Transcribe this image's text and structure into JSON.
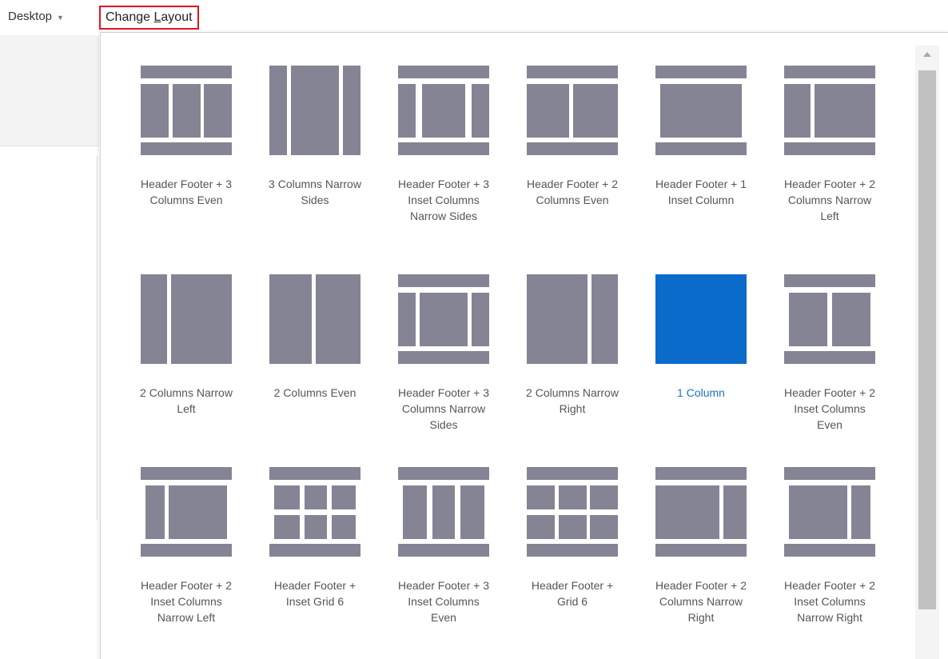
{
  "topbar": {
    "device": "Desktop",
    "change_layout_pre": "Change ",
    "change_layout_key": "L",
    "change_layout_post": "ayout"
  },
  "layouts": [
    "Header Footer + 3 Columns Even",
    "3 Columns Narrow Sides",
    "Header Footer + 3 Inset Columns Narrow Sides",
    "Header Footer + 2 Columns Even",
    "Header Footer + 1 Inset Column",
    "Header Footer + 2 Columns Narrow Left",
    "2 Columns Narrow Left",
    "2 Columns Even",
    "Header Footer + 3 Columns Narrow Sides",
    "2 Columns Narrow Right",
    "1 Column",
    "Header Footer + 2 Inset Columns Even",
    "Header Footer + 2 Inset Columns Narrow Left",
    "Header Footer + Inset Grid 6",
    "Header Footer + 3 Inset Columns Even",
    "Header Footer + Grid 6",
    "Header Footer + 2 Columns Narrow Right",
    "Header Footer + 2 Inset Columns Narrow Right"
  ],
  "selected_layout": "1 Column",
  "colors": {
    "thumb": "#858494",
    "selected": "#0b6bca",
    "highlight_border": "#e0141e"
  }
}
